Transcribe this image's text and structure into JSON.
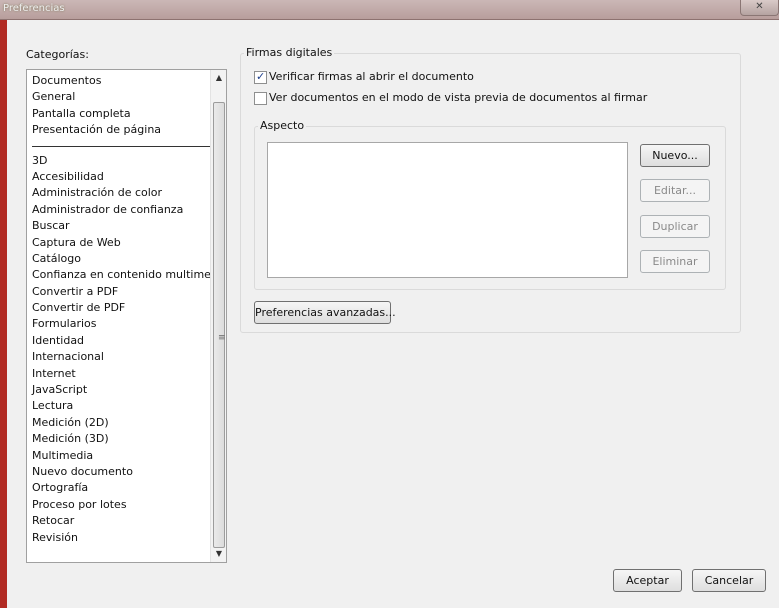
{
  "window": {
    "title": "Preferencias",
    "close_glyph": "✕"
  },
  "categories": {
    "label": "Categorías:",
    "top_items": [
      "Documentos",
      "General",
      "Pantalla completa",
      "Presentación de página"
    ],
    "items": [
      "3D",
      "Accesibilidad",
      "Administración de color",
      "Administrador de confianza",
      "Buscar",
      "Captura de Web",
      "Catálogo",
      "Confianza en contenido multimedia",
      "Convertir a PDF",
      "Convertir de PDF",
      "Formularios",
      "Identidad",
      "Internacional",
      "Internet",
      "JavaScript",
      "Lectura",
      "Medición (2D)",
      "Medición (3D)",
      "Multimedia",
      "Nuevo documento",
      "Ortografía",
      "Proceso por lotes",
      "Retocar",
      "Revisión"
    ],
    "scroll_up_glyph": "▲",
    "scroll_down_glyph": "▼",
    "scroll_grip_glyph": "≡"
  },
  "firmas": {
    "group_title": "Firmas digitales",
    "verify_label": "Verificar firmas al abrir el documento",
    "verify_checked": true,
    "preview_label": "Ver documentos en el modo de vista previa de documentos al firmar",
    "preview_checked": false,
    "check_glyph": "✓",
    "aspecto": {
      "group_title": "Aspecto",
      "buttons": {
        "nuevo": "Nuevo...",
        "editar": "Editar...",
        "duplicar": "Duplicar",
        "eliminar": "Eliminar"
      }
    },
    "advanced_button": "Preferencias avanzadas..."
  },
  "footer": {
    "ok_button": "Aceptar",
    "cancel_button": "Cancelar"
  },
  "colors": {
    "title_bar": "#c0a8a7",
    "left_edge": "#b12a23",
    "checkmark": "#1c3e8c"
  }
}
